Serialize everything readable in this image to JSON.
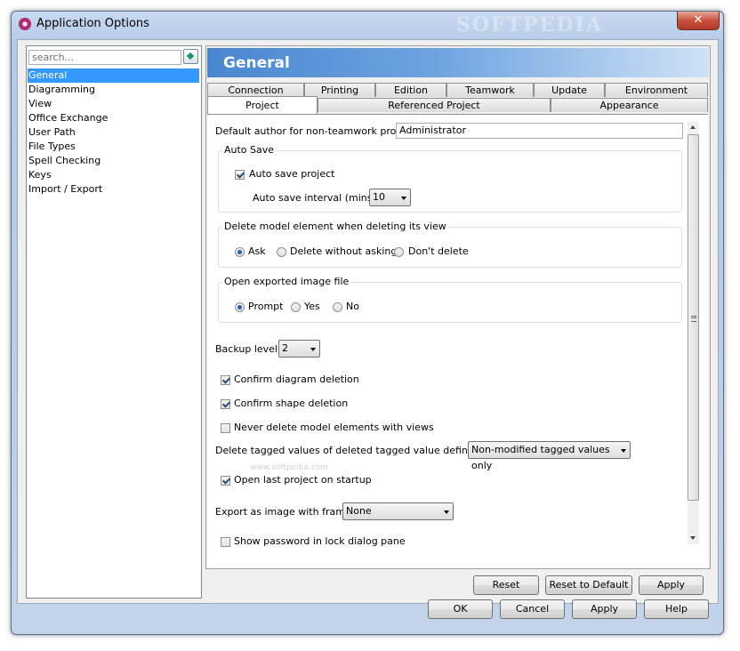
{
  "window": {
    "title": "Application Options",
    "watermark": "SOFTPEDIA",
    "close_glyph": "✕"
  },
  "sidebar": {
    "search_placeholder": "search...",
    "items": [
      {
        "label": "General"
      },
      {
        "label": "Diagramming"
      },
      {
        "label": "View"
      },
      {
        "label": "Office Exchange"
      },
      {
        "label": "User Path"
      },
      {
        "label": "File Types"
      },
      {
        "label": "Spell Checking"
      },
      {
        "label": "Keys"
      },
      {
        "label": "Import / Export"
      }
    ],
    "selected": "General"
  },
  "panel": {
    "title": "General",
    "tabs_row1": [
      "Connection",
      "Printing",
      "Edition",
      "Teamwork",
      "Update",
      "Environment"
    ],
    "tabs_row2": [
      "Project",
      "Referenced Project",
      "Appearance"
    ],
    "active_tab": "Project"
  },
  "project": {
    "default_author_label": "Default author for non-teamwork project:",
    "default_author_value": "Administrator",
    "autosave": {
      "group_title": "Auto Save",
      "checkbox_label": "Auto save project",
      "checked": true,
      "interval_label": "Auto save interval (mins) :",
      "interval_value": "10"
    },
    "delete_model": {
      "group_title": "Delete model element when deleting its view",
      "options": [
        "Ask",
        "Delete without asking",
        "Don't delete"
      ],
      "selected": "Ask"
    },
    "open_image": {
      "group_title": "Open exported image file",
      "options": [
        "Prompt",
        "Yes",
        "No"
      ],
      "selected": "Prompt"
    },
    "backup_label": "Backup level :",
    "backup_value": "2",
    "confirm_diagram": {
      "label": "Confirm diagram deletion",
      "checked": true
    },
    "confirm_shape": {
      "label": "Confirm shape deletion",
      "checked": true
    },
    "never_delete": {
      "label": "Never delete model elements with views",
      "checked": false
    },
    "delete_tagged_label": "Delete tagged values of deleted tagged value definitions :",
    "delete_tagged_value": "Non-modified tagged values only",
    "open_last": {
      "label": "Open last project on startup",
      "checked": true
    },
    "export_frame_label": "Export as image with frame :",
    "export_frame_value": "None",
    "show_password": {
      "label": "Show password in lock dialog pane",
      "checked": false
    }
  },
  "panel_buttons": {
    "reset": "Reset",
    "reset_default": "Reset to Default",
    "apply": "Apply"
  },
  "dialog_buttons": {
    "ok": "OK",
    "cancel": "Cancel",
    "apply": "Apply",
    "help": "Help"
  },
  "watermark_small": "www.softpedia.com"
}
